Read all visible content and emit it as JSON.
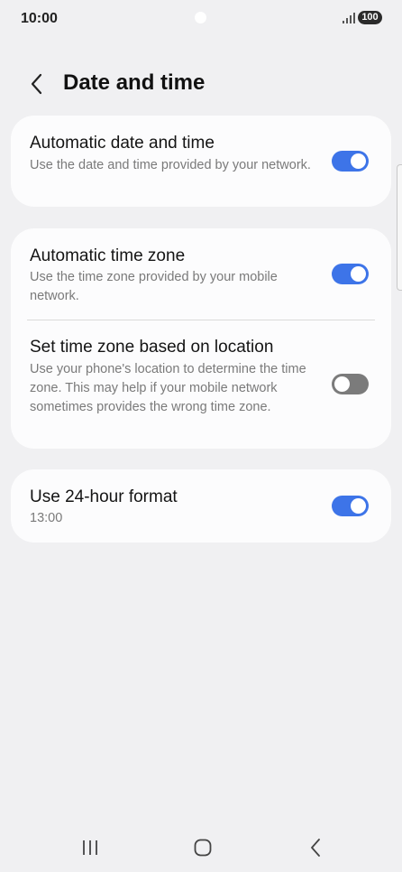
{
  "status_bar": {
    "time": "10:00",
    "battery": "100",
    "icons": [
      "signal-icon",
      "battery-icon"
    ]
  },
  "header": {
    "title": "Date and time",
    "back_icon": "chevron-left-icon"
  },
  "settings": {
    "auto_date_time": {
      "title": "Automatic date and time",
      "subtitle": "Use the date and time provided by your network.",
      "enabled": true
    },
    "auto_time_zone": {
      "title": "Automatic time zone",
      "subtitle": "Use the time zone provided by your mobile network.",
      "enabled": true
    },
    "location_time_zone": {
      "title": "Set time zone based on location",
      "subtitle": "Use your phone's location to determine the time zone. This may help if your mobile network sometimes provides the wrong time zone.",
      "enabled": false
    },
    "hour_24_format": {
      "title": "Use 24-hour format",
      "subtitle": "13:00",
      "enabled": true
    }
  },
  "nav_bar": {
    "icons": [
      "recent-apps-icon",
      "home-icon",
      "back-icon"
    ]
  },
  "colors": {
    "background": "#f0f0f2",
    "card": "#fcfcfd",
    "toggle_on": "#3d74e8",
    "toggle_off": "#7b7b7b"
  }
}
